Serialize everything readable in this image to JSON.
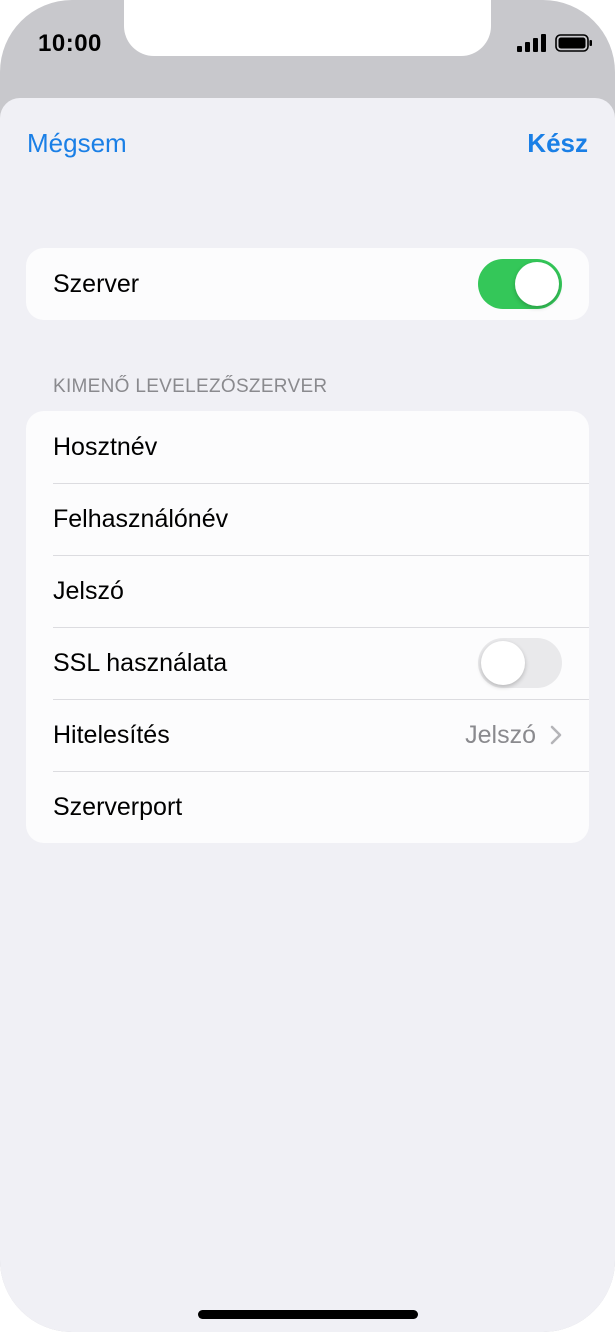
{
  "status_bar": {
    "time": "10:00",
    "signal_icon": "cellular-signal-icon",
    "battery_icon": "battery-icon"
  },
  "nav": {
    "cancel_label": "Mégsem",
    "done_label": "Kész"
  },
  "server_group": {
    "label": "Szerver",
    "toggle_on": true
  },
  "outgoing_section": {
    "header": "KIMENŐ LEVELEZŐSZERVER",
    "rows": [
      {
        "label": "Hosztnév"
      },
      {
        "label": "Felhasználónév"
      },
      {
        "label": "Jelszó"
      },
      {
        "label": "SSL használata",
        "toggle_on": false
      },
      {
        "label": "Hitelesítés",
        "value": "Jelszó",
        "icon": "chevron-right-icon"
      },
      {
        "label": "Szerverport"
      }
    ]
  },
  "colors": {
    "accent": "#1a7fe6",
    "toggle_on": "#34c759",
    "toggle_off": "#e9e9eb",
    "background": "#f0f0f5"
  }
}
